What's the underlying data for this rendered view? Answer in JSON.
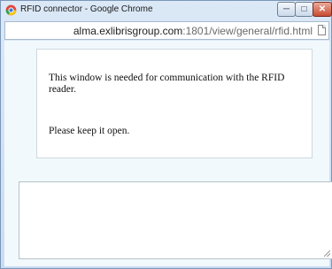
{
  "window": {
    "title": "RFID connector - Google Chrome",
    "controls": {
      "minimize": "─",
      "maximize": "□",
      "close": "✕"
    }
  },
  "address_bar": {
    "url_host": "alma.exlibrisgroup.com",
    "url_rest": ":1801/view/general/rfid.html"
  },
  "message": {
    "line1": "This window is needed for communication with the RFID reader.",
    "line2": "Please keep it open."
  },
  "textarea": {
    "value": ""
  },
  "icons": {
    "app": "chrome-logo-icon",
    "page": "page-icon"
  }
}
